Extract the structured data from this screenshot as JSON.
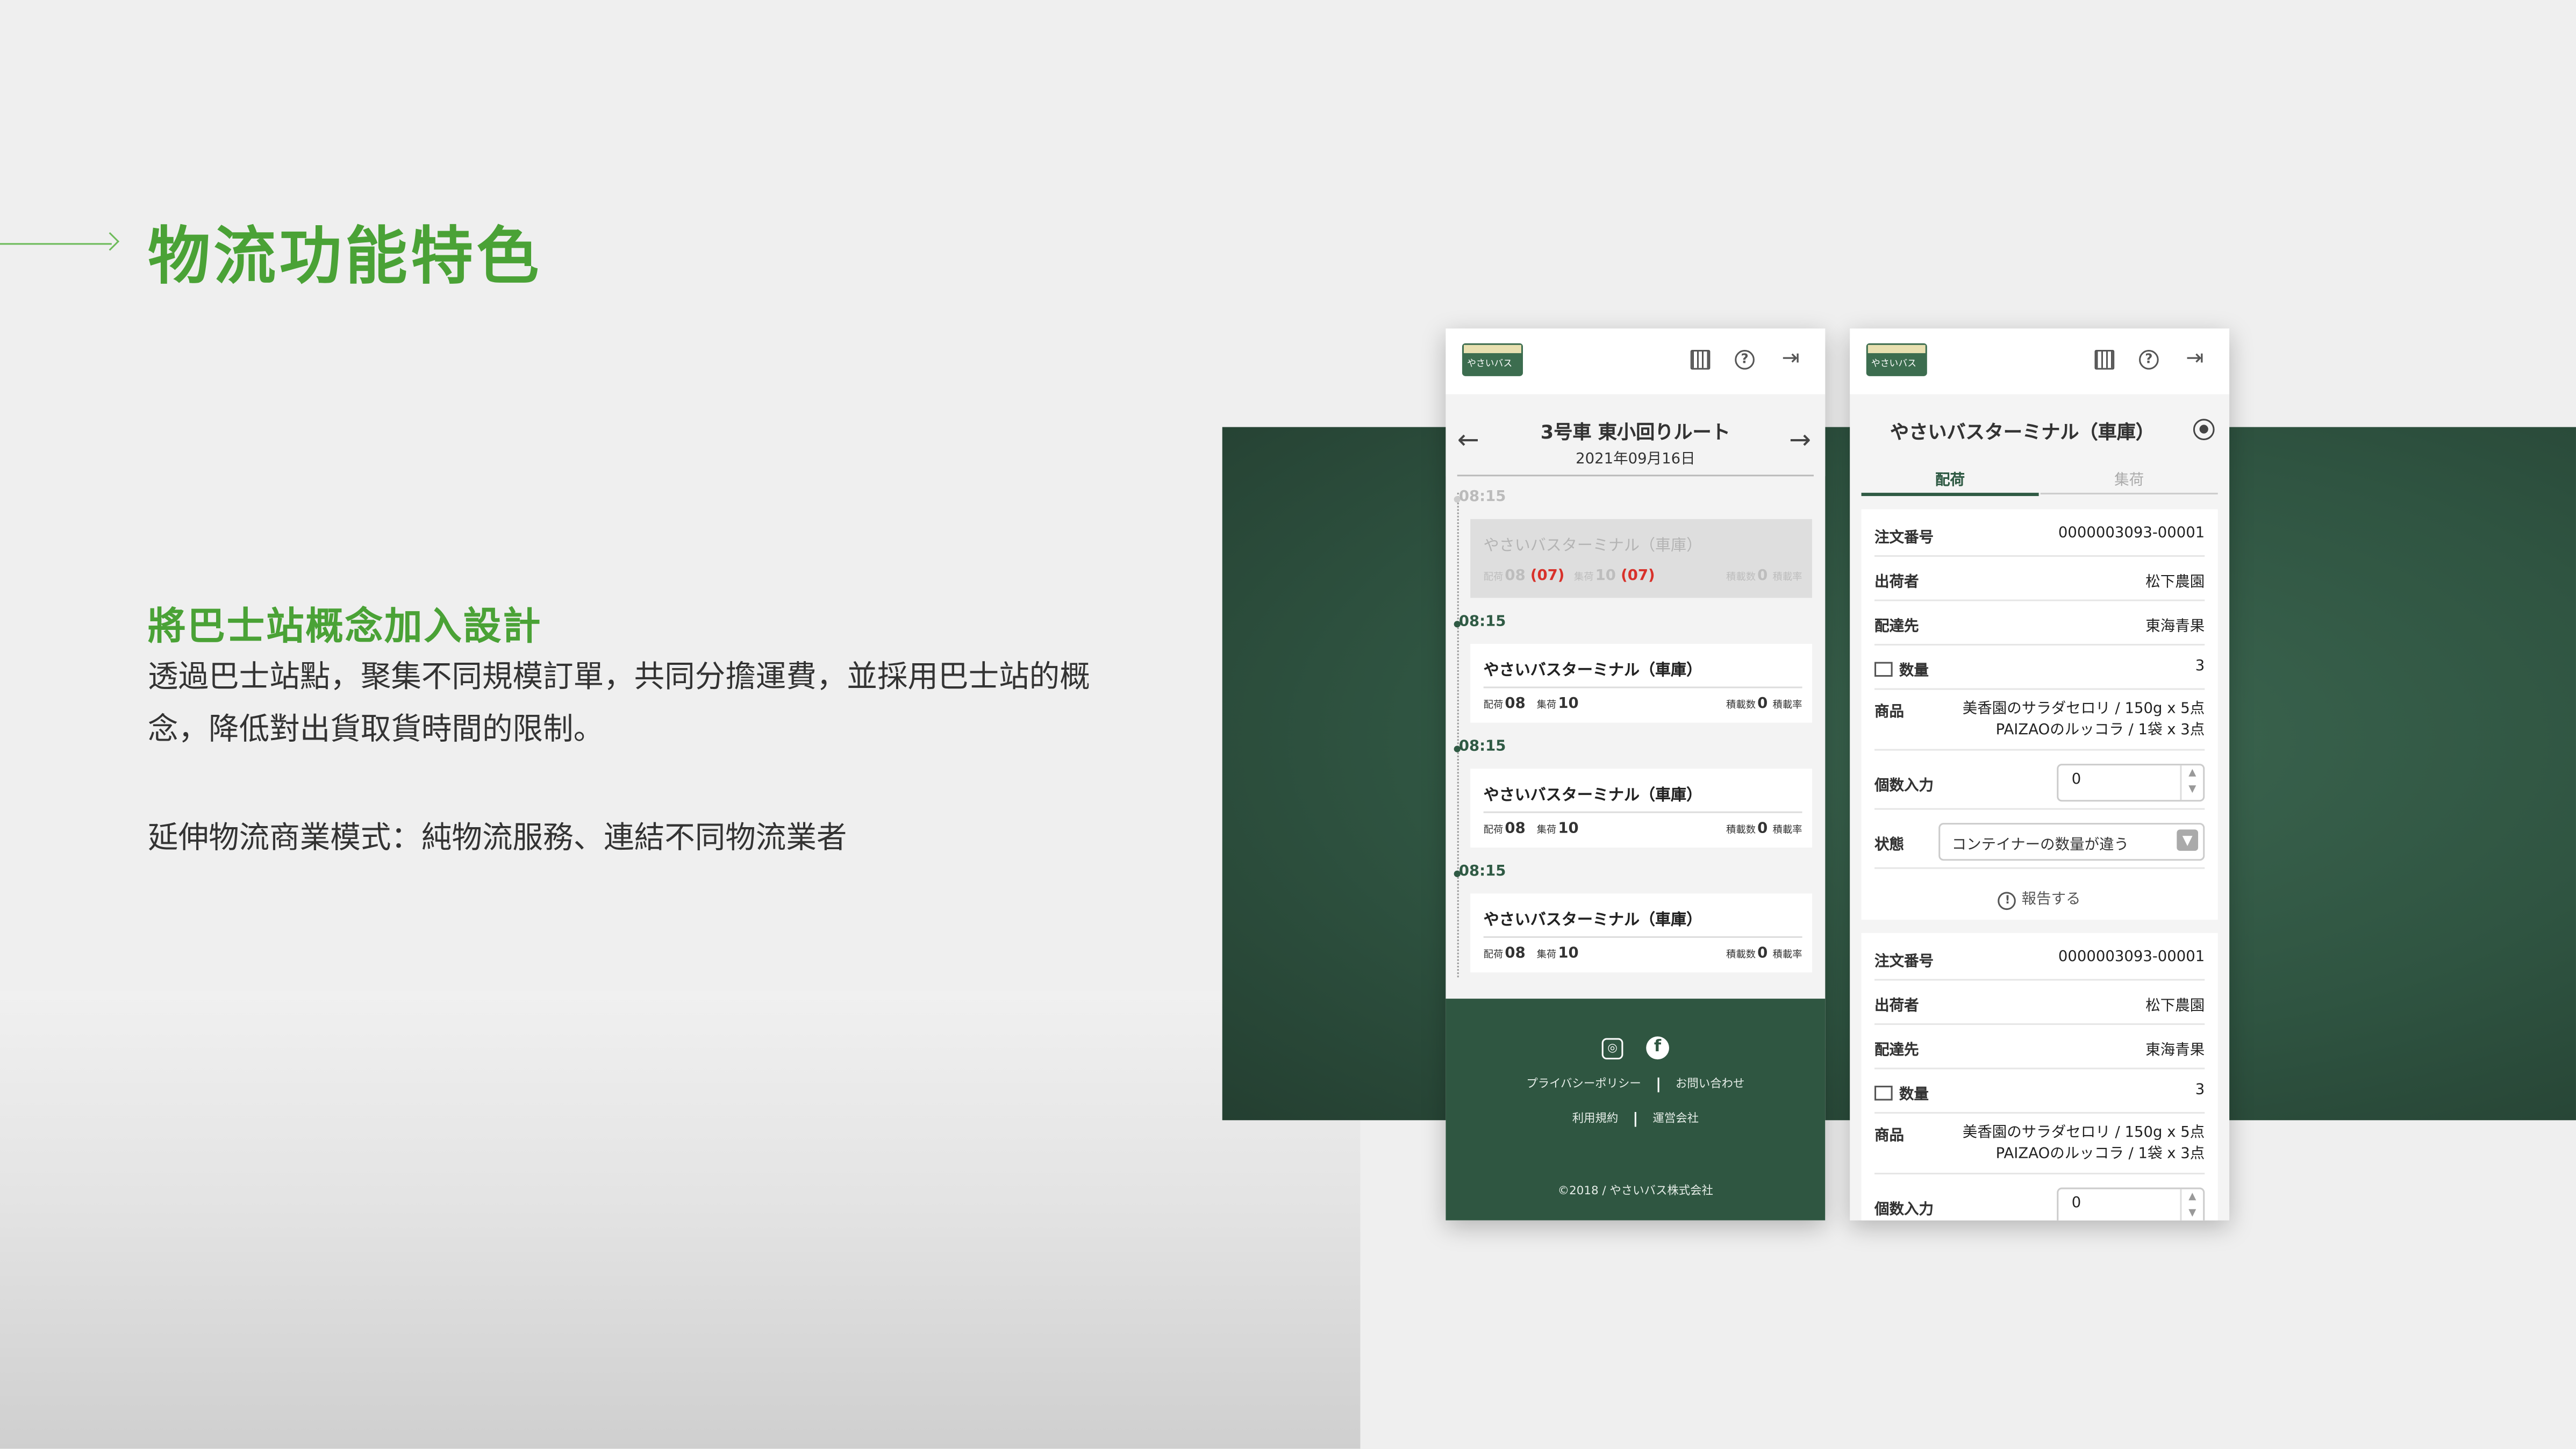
{
  "slide": {
    "title": "物流功能特色",
    "subtitle": "將巴士站概念加入設計",
    "body1": "透過巴士站點，聚集不同規模訂單，共同分擔運費，並採用巴士站的概念，降低對出貨取貨時間的限制。",
    "body2": "延伸物流商業模式：純物流服務、連結不同物流業者"
  },
  "app": {
    "logo_text": "やさいバス",
    "icons": [
      "calendar-icon",
      "help-icon",
      "logout-icon"
    ],
    "accent_color": "#2f5641",
    "title_green": "#4aa236"
  },
  "route_screen": {
    "route_title": "3号車 東小回りルート",
    "date": "2021年09月16日",
    "stops": [
      {
        "time": "08:15",
        "name": "やさいバスターミナル（車庫）",
        "dl_label": "配荷",
        "dl": "08",
        "dl_extra": "(07)",
        "pu_label": "集荷",
        "pu": "10",
        "pu_extra": "(07)",
        "load_label": "積載数",
        "load": "0",
        "rate_label": "積載率",
        "dim": true
      },
      {
        "time": "08:15",
        "name": "やさいバスターミナル（車庫）",
        "dl_label": "配荷",
        "dl": "08",
        "pu_label": "集荷",
        "pu": "10",
        "load_label": "積載数",
        "load": "0",
        "rate_label": "積載率"
      },
      {
        "time": "08:15",
        "name": "やさいバスターミナル（車庫）",
        "dl_label": "配荷",
        "dl": "08",
        "pu_label": "集荷",
        "pu": "10",
        "load_label": "積載数",
        "load": "0",
        "rate_label": "積載率"
      },
      {
        "time": "08:15",
        "name": "やさいバスターミナル（車庫）",
        "dl_label": "配荷",
        "dl": "08",
        "pu_label": "集荷",
        "pu": "10",
        "load_label": "積載数",
        "load": "0",
        "rate_label": "積載率"
      }
    ],
    "footer": {
      "links_row1": [
        "プライバシーポリシー",
        "お問い合わせ"
      ],
      "links_row2": [
        "利用規約",
        "運営会社"
      ],
      "copyright": "©2018 / やさいバス株式会社"
    }
  },
  "terminal_screen": {
    "title": "やさいバスターミナル（車庫）",
    "tabs": [
      "配荷",
      "集荷"
    ],
    "orders": [
      {
        "order_label": "注文番号",
        "order_no": "0000003093-00001",
        "shipper_label": "出荷者",
        "shipper": "松下農園",
        "dest_label": "配達先",
        "dest": "東海青果",
        "qty_label": "数量",
        "qty": "3",
        "product_label": "商品",
        "product_line1": "美香園のサラダセロリ / 150g x 5点",
        "product_line2": "PAIZAOのルッコラ / 1袋  x 3点",
        "count_label": "個数入力",
        "count_value": "0",
        "status_label": "状態",
        "status_value": "コンテイナーの数量が違う",
        "report_label": "報告する"
      },
      {
        "order_label": "注文番号",
        "order_no": "0000003093-00001",
        "shipper_label": "出荷者",
        "shipper": "松下農園",
        "dest_label": "配達先",
        "dest": "東海青果",
        "qty_label": "数量",
        "qty": "3",
        "product_label": "商品",
        "product_line1": "美香園のサラダセロリ / 150g x 5点",
        "product_line2": "PAIZAOのルッコラ / 1袋  x 3点",
        "count_label": "個数入力",
        "count_value": "0"
      }
    ]
  }
}
